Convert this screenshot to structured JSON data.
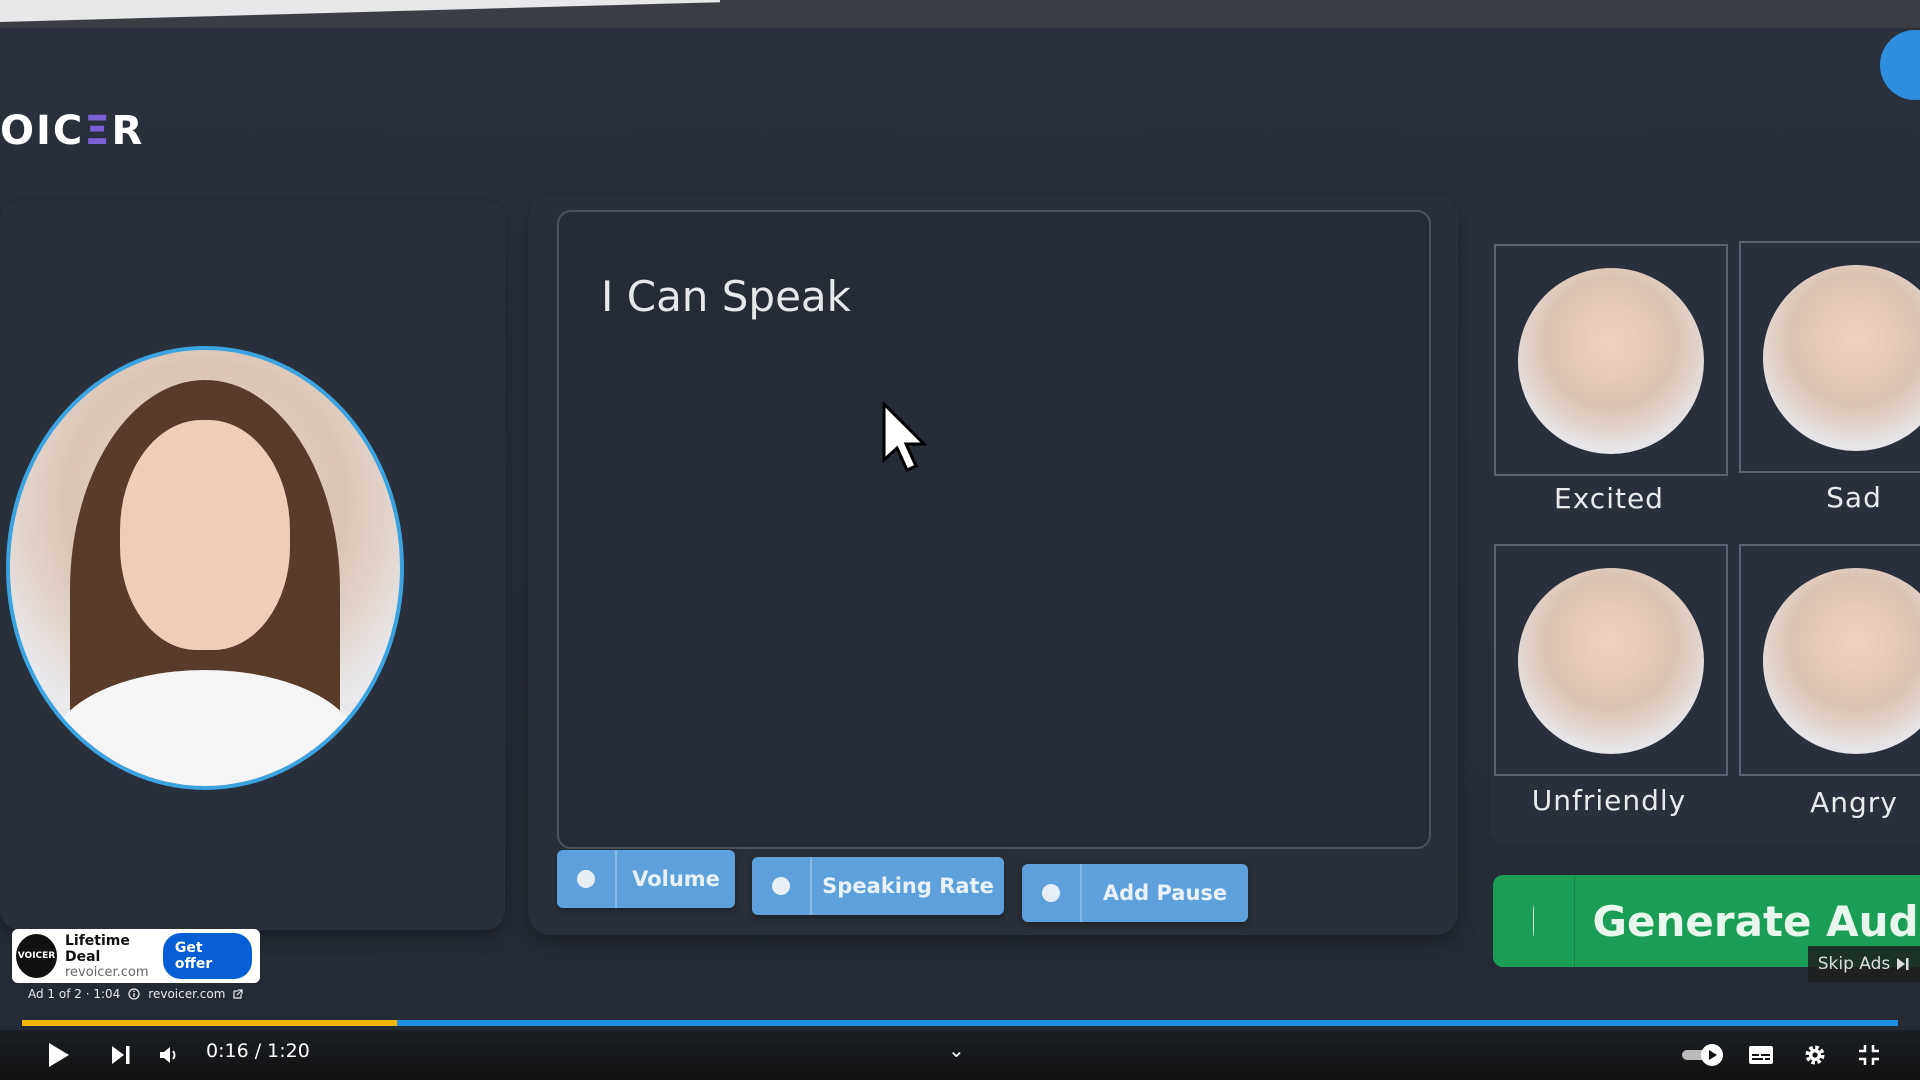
{
  "app": {
    "logo_text": "OIC",
    "logo_accent": "Ξ",
    "logo_end": "R"
  },
  "editor": {
    "text": "I Can Speak"
  },
  "controls": {
    "volume": "Volume",
    "speaking_rate": "Speaking Rate",
    "add_pause": "Add Pause"
  },
  "emotions": [
    {
      "label": "Excited"
    },
    {
      "label": "Sad"
    },
    {
      "label": "Unfriendly"
    },
    {
      "label": "Angry"
    }
  ],
  "generate": {
    "label": "Generate Audi"
  },
  "ad": {
    "logo": "VOICER",
    "title": "Lifetime Deal",
    "domain": "revoicer.com",
    "cta": "Get offer",
    "meta": "Ad 1 of 2 · 1:04",
    "link": "revoicer.com",
    "skip": "Skip Ads"
  },
  "player": {
    "time": "0:16 / 1:20",
    "progress_fraction": 0.2,
    "buffered_fraction": 1.0
  },
  "colors": {
    "accent_blue": "#5da0db",
    "generate_green": "#1a9e56",
    "progress_yellow": "#f2b705"
  }
}
